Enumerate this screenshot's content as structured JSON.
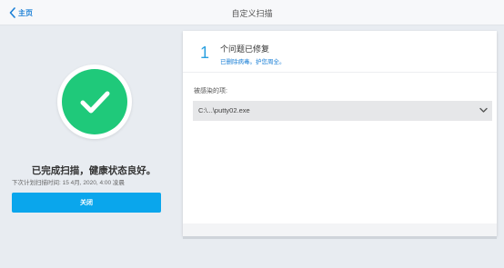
{
  "header": {
    "back_label": "主页",
    "title": "自定义扫描"
  },
  "status": {
    "done_text": "已完成扫描，健康状态良好。",
    "next_scan": "下次计划扫描时间: 15 4月, 2020, 4:00 凌晨",
    "close_label": "关闭"
  },
  "issues": {
    "count": "1",
    "title": "个问题已修复",
    "subtitle": "已删除病毒。护您周全。",
    "infected_label": "被感染的项:",
    "file_selected": "C:\\...\\putty02.exe"
  },
  "icons": {
    "back": "chevron-left-icon",
    "success": "checkmark-icon",
    "dropdown": "chevron-down-icon"
  },
  "colors": {
    "accent": "#0aa6ec",
    "success": "#1fc97a",
    "link": "#1a7fd6"
  }
}
